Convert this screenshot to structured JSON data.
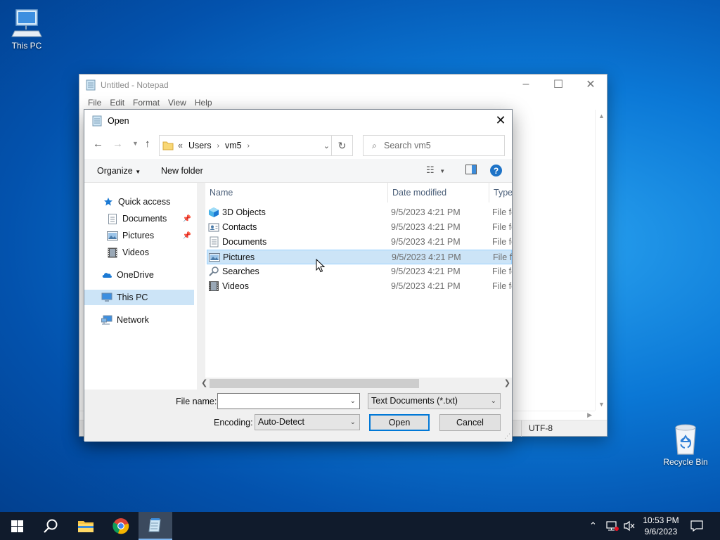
{
  "desktop": {
    "icons": [
      {
        "label": "This PC"
      },
      {
        "label": "Recycle Bin"
      }
    ]
  },
  "notepad": {
    "title": "Untitled - Notepad",
    "menu": [
      "File",
      "Edit",
      "Format",
      "View",
      "Help"
    ],
    "status_encoding": "UTF-8"
  },
  "dialog": {
    "title": "Open",
    "breadcrumb": [
      "Users",
      "vm5"
    ],
    "breadcrumb_prefix": "«",
    "search_placeholder": "Search vm5",
    "organize_label": "Organize",
    "new_folder_label": "New folder",
    "nav": [
      {
        "label": "Quick access",
        "icon": "star-icon"
      },
      {
        "label": "Documents",
        "icon": "documents-icon",
        "pinned": true
      },
      {
        "label": "Pictures",
        "icon": "pictures-icon",
        "pinned": true
      },
      {
        "label": "Videos",
        "icon": "videos-icon"
      },
      {
        "label": "OneDrive",
        "icon": "onedrive-icon"
      },
      {
        "label": "This PC",
        "icon": "this-pc-icon",
        "selected": true
      },
      {
        "label": "Network",
        "icon": "network-icon"
      }
    ],
    "columns": [
      "Name",
      "Date modified",
      "Type"
    ],
    "files": [
      {
        "name": "3D Objects",
        "date": "9/5/2023 4:21 PM",
        "type": "File fo",
        "icon": "3d-objects-icon"
      },
      {
        "name": "Contacts",
        "date": "9/5/2023 4:21 PM",
        "type": "File fo",
        "icon": "contacts-icon"
      },
      {
        "name": "Documents",
        "date": "9/5/2023 4:21 PM",
        "type": "File fo",
        "icon": "documents-icon"
      },
      {
        "name": "Pictures",
        "date": "9/5/2023 4:21 PM",
        "type": "File fo",
        "icon": "pictures-icon",
        "selected": true
      },
      {
        "name": "Searches",
        "date": "9/5/2023 4:21 PM",
        "type": "File fo",
        "icon": "searches-icon"
      },
      {
        "name": "Videos",
        "date": "9/5/2023 4:21 PM",
        "type": "File fo",
        "icon": "videos-icon"
      }
    ],
    "file_name_label": "File name:",
    "file_name_value": "",
    "file_type_value": "Text Documents (*.txt)",
    "encoding_label": "Encoding:",
    "encoding_value": "Auto-Detect",
    "open_label": "Open",
    "cancel_label": "Cancel"
  },
  "taskbar": {
    "time": "10:53 PM",
    "date": "9/6/2023"
  },
  "colors": {
    "accent": "#0078d7",
    "selection": "#cce4f7",
    "taskbar": "#101b2c"
  }
}
